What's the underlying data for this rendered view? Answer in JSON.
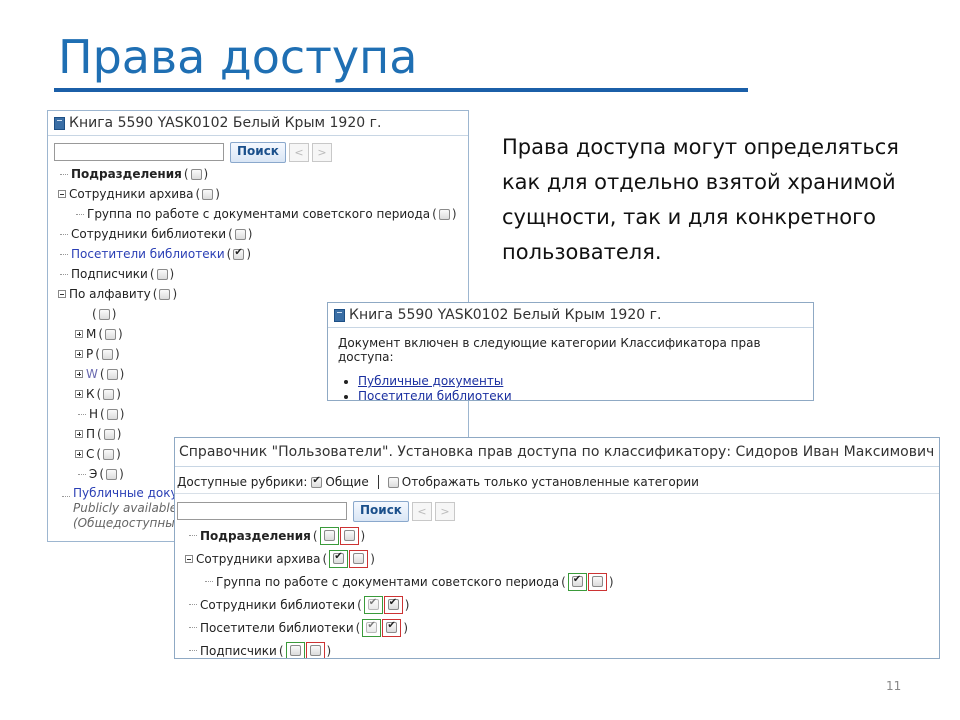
{
  "slide": {
    "title": "Права доступа",
    "description": "Права доступа могут определяться как для отдельно взятой хранимой сущности, так и для конкретного пользователя.",
    "page_number": "11"
  },
  "panel1": {
    "title": "Книга 5590 YASK0102 Белый Крым 1920 г.",
    "search_button": "Поиск",
    "prev": "<",
    "next": ">",
    "items": [
      {
        "label": "Подразделения",
        "checked": false
      },
      {
        "label": "Сотрудники архива",
        "checked": false
      },
      {
        "label": "Группа по работе с документами советского периода",
        "checked": false
      },
      {
        "label": "Сотрудники библиотеки",
        "checked": false
      },
      {
        "label": "Посетители библиотеки",
        "checked": true
      },
      {
        "label": "Подписчики",
        "checked": false
      },
      {
        "label": "По алфавиту",
        "checked": false
      },
      {
        "label": "",
        "checked": false
      },
      {
        "label": "М",
        "checked": false
      },
      {
        "label": "Р",
        "checked": false
      },
      {
        "label": "W",
        "checked": false
      },
      {
        "label": "К",
        "checked": false
      },
      {
        "label": "Н",
        "checked": false
      },
      {
        "label": "П",
        "checked": false
      },
      {
        "label": "С",
        "checked": false
      },
      {
        "label": "Э",
        "checked": false
      }
    ],
    "footer_link": "Публичные доку",
    "footer_en": "Publicly available",
    "footer_ru": "(Общедоступны"
  },
  "panel2": {
    "title": "Книга 5590 YASK0102 Белый Крым 1920 г.",
    "text": "Документ включен в следующие категории Классификатора прав доступа:",
    "links": [
      "Публичные документы",
      "Посетители библиотеки"
    ]
  },
  "panel3": {
    "title": "Справочник \"Пользователи\". Установка прав доступа по классификатору: Сидоров Иван Максимович",
    "filter_label": "Доступные рубрики:",
    "filter_general": "Общие",
    "filter_show_only": "Отображать только установленные категории",
    "search_button": "Поиск",
    "prev": "<",
    "next": ">",
    "rows": [
      {
        "label": "Подразделения",
        "green": false,
        "red": false
      },
      {
        "label": "Сотрудники архива",
        "green": true,
        "red": false
      },
      {
        "label": "Группа по работе с документами советского периода",
        "green": true,
        "red": false
      },
      {
        "label": "Сотрудники библиотеки",
        "green": true,
        "red": true
      },
      {
        "label": "Посетители библиотеки",
        "green": true,
        "red": true
      },
      {
        "label": "Подписчики",
        "green": false,
        "red": false
      }
    ]
  },
  "colors": {
    "title": "#1f6fb3",
    "rule": "#1b5fa8",
    "panel_border": "#9db6d0",
    "allow_border": "#3a9a3a",
    "deny_border": "#cc3333"
  }
}
